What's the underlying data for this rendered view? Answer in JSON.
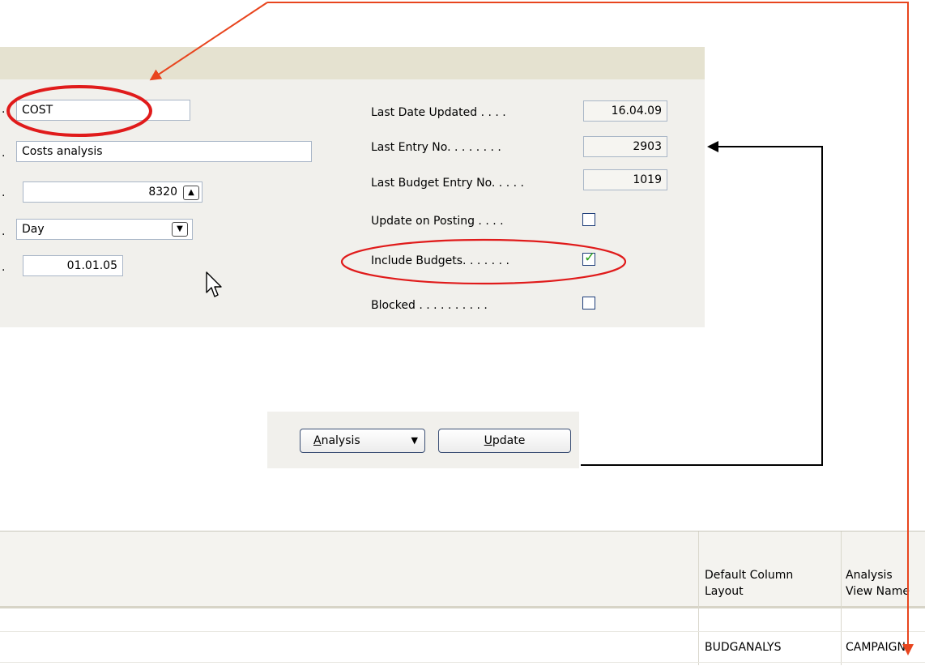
{
  "form": {
    "code_value": "COST",
    "name_value": "Costs analysis",
    "account_filter_value": "8320",
    "date_compression_value": "Day",
    "starting_date_value": "01.01.05",
    "last_date_updated_label": "Last Date Updated",
    "last_date_updated_value": "16.04.09",
    "last_entry_no_label": "Last Entry No.",
    "last_entry_no_value": "2903",
    "last_budget_entry_no_label": "Last Budget Entry No.",
    "last_budget_entry_no_value": "1019",
    "update_on_posting_label": "Update on Posting",
    "include_budgets_label": "Include Budgets.",
    "blocked_label": "Blocked"
  },
  "buttons": {
    "analysis_label_first": "A",
    "analysis_label_rest": "nalysis",
    "update_label_first": "U",
    "update_label_rest": "pdate"
  },
  "table": {
    "columns": [
      "Default Column\nLayout",
      "Analysis\nView Name"
    ],
    "col1_line1": "Default Column",
    "col1_line2": "Layout",
    "col2_line1": "Analysis",
    "col2_line2": "View Name",
    "rows": [
      {
        "default_column_layout": "",
        "analysis_view_name": ""
      },
      {
        "default_column_layout": "BUDGANALYS",
        "analysis_view_name": "CAMPAIGN"
      }
    ],
    "row2_col1": "BUDGANALYS",
    "row2_col2": "CAMPAIGN"
  },
  "icons": {
    "lookup": "arrow-up-icon",
    "dropdown": "arrow-down-icon",
    "cursor": "mouse-pointer-icon"
  },
  "colors": {
    "annotation_red": "#e8451e",
    "highlight_red": "#e01b1b",
    "check_green": "#2aa21a"
  }
}
